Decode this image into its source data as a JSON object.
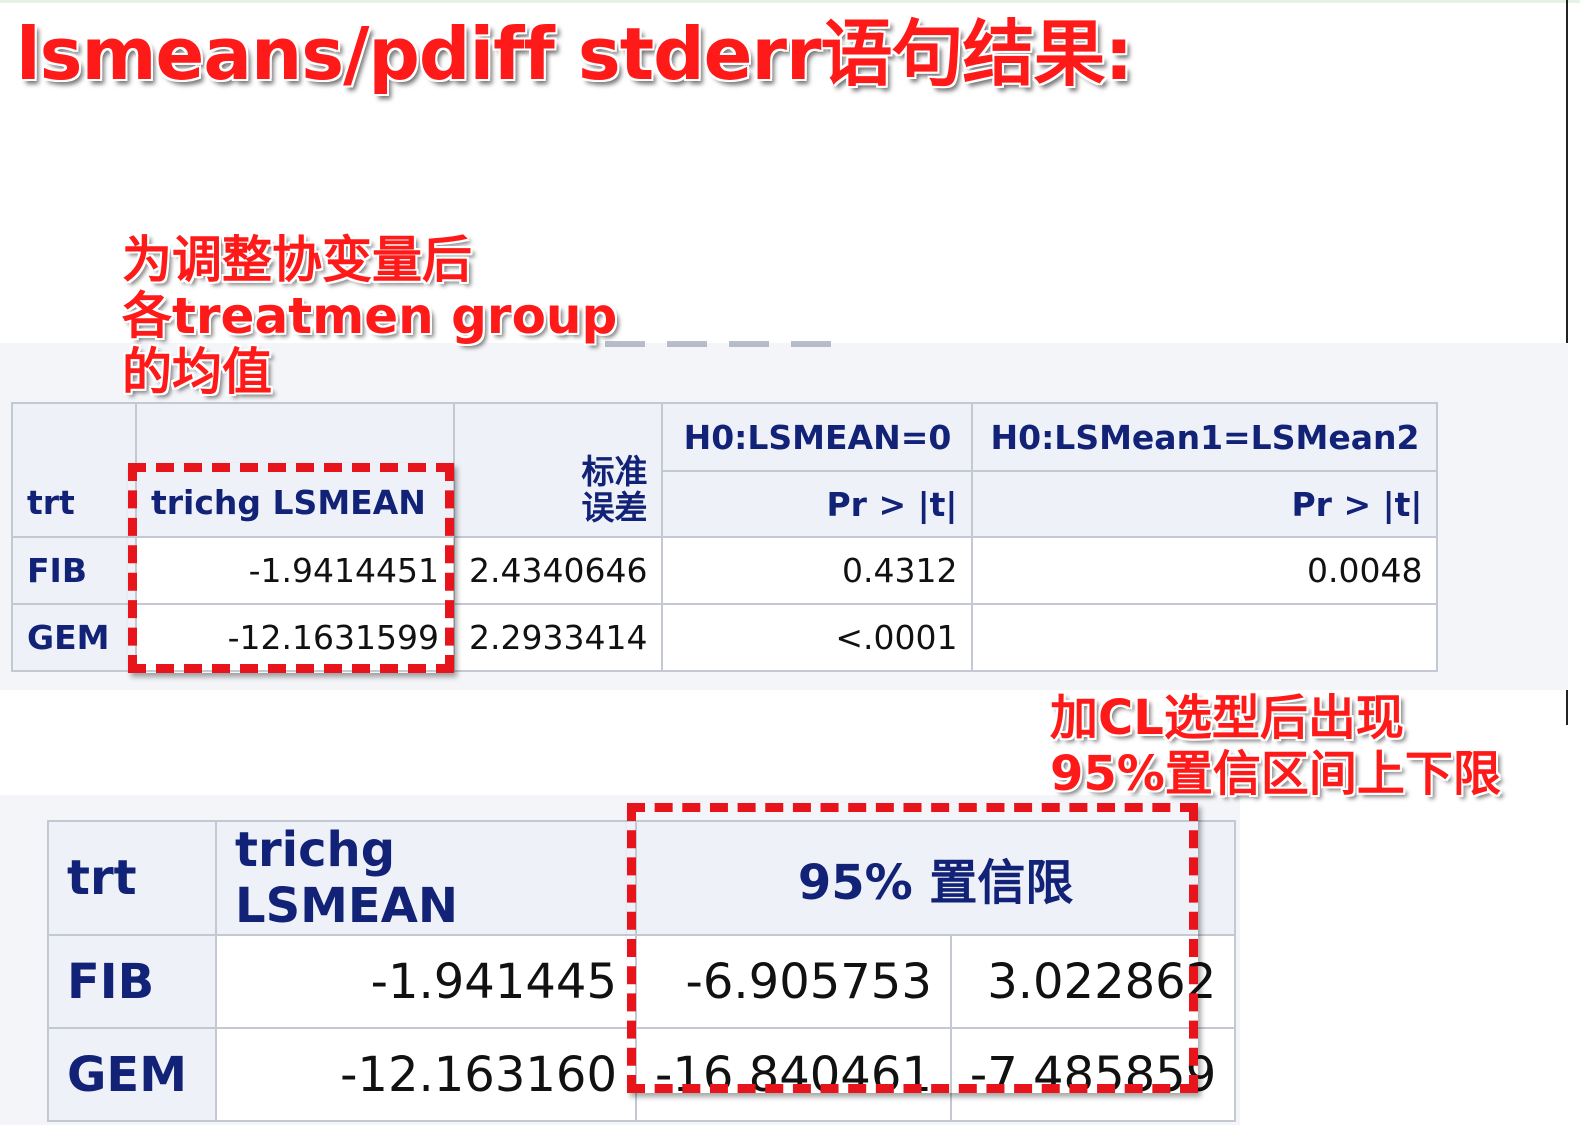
{
  "title": "lsmeans/pdiff stderr语句结果:",
  "annotations": {
    "lsmean_note": [
      "为调整协变量后",
      "各treatmen group",
      "的均值"
    ],
    "cl_note": [
      "加CL选型后出现",
      "95%置信区间上下限"
    ]
  },
  "table1": {
    "headers": {
      "trt": "trt",
      "lsmean": "trichg LSMEAN",
      "stderr_line1": "标准",
      "stderr_line2": "误差",
      "h0_lsmean0": "H0:LSMEAN=0",
      "h0_lsmean12": "H0:LSMean1=LSMean2",
      "pr_t_1": "Pr > |t|",
      "pr_t_2": "Pr > |t|"
    },
    "rows": [
      {
        "trt": "FIB",
        "lsmean": "-1.9414451",
        "stderr": "2.4340646",
        "p_zero": "0.4312",
        "p_diff": "0.0048"
      },
      {
        "trt": "GEM",
        "lsmean": "-12.1631599",
        "stderr": "2.2933414",
        "p_zero": "<.0001",
        "p_diff": ""
      }
    ]
  },
  "table2": {
    "headers": {
      "trt": "trt",
      "lsmean": "trichg LSMEAN",
      "cl": "95% 置信限"
    },
    "rows": [
      {
        "trt": "FIB",
        "lsmean": "-1.941445",
        "lower": "-6.905753",
        "upper": "3.022862"
      },
      {
        "trt": "GEM",
        "lsmean": "-12.163160",
        "lower": "-16.840461",
        "upper": "-7.485859"
      }
    ]
  },
  "colors": {
    "annotation_red": "#ff1a1a",
    "dash_red": "#e8141b",
    "header_text": "#112277",
    "header_bg": "#eef1f7",
    "grid": "#c3c8d2"
  }
}
